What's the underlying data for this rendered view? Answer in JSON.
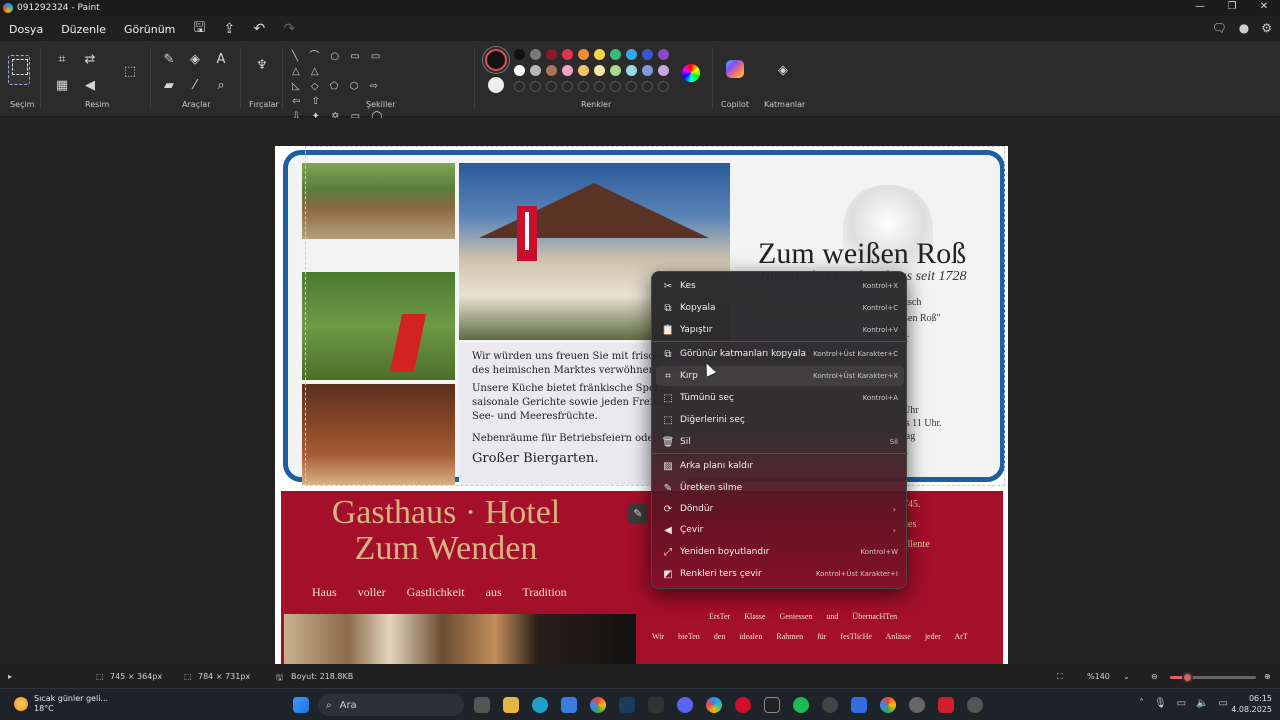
{
  "window": {
    "title": "091292324 - Paint",
    "controls": [
      "—",
      "❐",
      "✕"
    ]
  },
  "menu": {
    "items": [
      "Dosya",
      "Düzenle",
      "Görünüm"
    ]
  },
  "ribbon": {
    "groups": {
      "selection": "Seçim",
      "image": "Resim",
      "tools": "Araçlar",
      "brushes": "Fırçalar",
      "shapes": "Şekiller",
      "colors": "Renkler",
      "copilot": "Copilot",
      "layers": "Katmanlar"
    },
    "colors": {
      "current_primary": "#111111",
      "current_secondary": "#eeeeee",
      "row1": [
        "#111111",
        "#7a7a7a",
        "#8b1a2b",
        "#e0344f",
        "#f08a3c",
        "#f5d547",
        "#3cb878",
        "#37a6e8",
        "#3c58c8",
        "#8a48c6"
      ],
      "row2": [
        "#ffffff",
        "#b8b8b8",
        "#a7765a",
        "#f3a3c3",
        "#f5c26b",
        "#eee9a6",
        "#a9dc8a",
        "#9ad8e8",
        "#7f9bd9",
        "#c3a8e3"
      ]
    }
  },
  "image_content": {
    "title_right": "Zum weißen Roß",
    "subtitle_right": "Historisches Landgasthaus seit 1728",
    "right_fragments": [
      "usch",
      "ßen Roß\"",
      "s.",
      "Uhr",
      "is 11 Uhr.",
      "tag"
    ],
    "text_panel": {
      "line1": "Wir würden uns freuen Sie mit frischen",
      "line2": "des heimischen Marktes verwöhnen zu d",
      "line3": "Unsere Küche bietet fränkische Spezial",
      "line4": "saisonale Gerichte sowie jeden Freitag",
      "line5": "See- und Meeresfrüchte.",
      "line6": "Nebenräume für Betriebsfeiern oder Fa",
      "line7": "Großer Biergarten."
    },
    "red_panel": {
      "title_line1": "Gasthaus · Hotel",
      "title_line2": "Zum Wenden",
      "tagline": "Haus voller Gastlichkeit aus Tradition",
      "frag1": "745.",
      "frag2": "nes",
      "frag3": "ellente",
      "klasse1": "ErsTer Klasse Geniessen und ÜbernacHTen",
      "klasse2": "Wir bieTen den idealen Rahmen für fesTlicHe Anlässe jeder ArT"
    }
  },
  "context_menu": {
    "items": [
      {
        "label": "Kes",
        "shortcut": "Kontrol+X",
        "icon": "✂"
      },
      {
        "label": "Kopyala",
        "shortcut": "Kontrol+C",
        "icon": "⧉"
      },
      {
        "label": "Yapıştır",
        "shortcut": "Kontrol+V",
        "icon": "📋"
      },
      {
        "label": "Görünür katmanları kopyala",
        "shortcut": "Kontrol+Üst Karakter+C",
        "icon": "⧉"
      },
      {
        "label": "Kırp",
        "shortcut": "Kontrol+Üst Karakter+X",
        "icon": "⌗"
      },
      {
        "label": "Tümünü seç",
        "shortcut": "Kontrol+A",
        "icon": "⬚"
      },
      {
        "label": "Diğerlerini seç",
        "shortcut": "",
        "icon": "⬚"
      },
      {
        "label": "Sil",
        "shortcut": "Sil",
        "icon": "🗑"
      },
      {
        "label": "Arka planı kaldır",
        "shortcut": "",
        "icon": "▨"
      },
      {
        "label": "Üretken silme",
        "shortcut": "",
        "icon": "✎"
      },
      {
        "label": "Döndür",
        "shortcut": "›",
        "icon": "⟳"
      },
      {
        "label": "Çevir",
        "shortcut": "›",
        "icon": "◀"
      },
      {
        "label": "Yeniden boyutlandır",
        "shortcut": "Kontrol+W",
        "icon": "⤢"
      },
      {
        "label": "Renkleri ters çevir",
        "shortcut": "Kontrol+Üst Karakter+I",
        "icon": "◩"
      }
    ]
  },
  "status": {
    "selection_size": "745 × 364px",
    "image_size": "784 × 731px",
    "file_size": "Boyut: 218.8KB",
    "zoom": "%140",
    "zoom_fraction": 0.2
  },
  "taskbar": {
    "weather_text": "Sıcak günler geli...",
    "temperature": "18°C",
    "search_placeholder": "Ara",
    "time": "06:15",
    "date": "4.08.2025"
  }
}
